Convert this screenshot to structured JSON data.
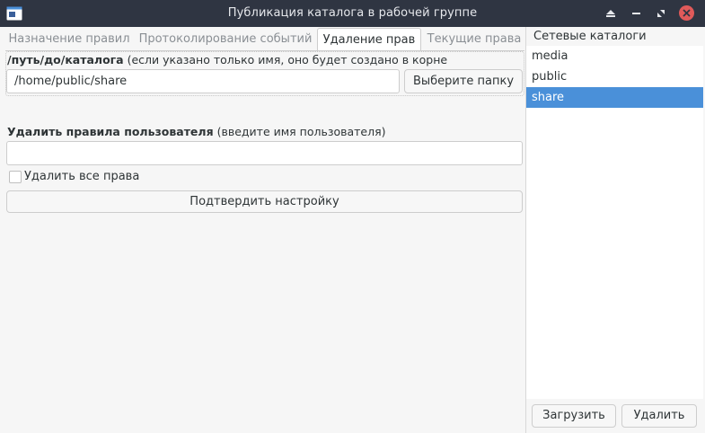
{
  "window": {
    "title": "Публикация каталога в рабочей группе",
    "accent_color": "#4a90d9",
    "close_color": "#e05a5a"
  },
  "tabs": [
    {
      "label": "Назначение правил",
      "active": false
    },
    {
      "label": "Протоколирование событий",
      "active": false
    },
    {
      "label": "Удаление прав",
      "active": true
    },
    {
      "label": "Текущие права",
      "active": false
    }
  ],
  "form": {
    "path_label_bold": "/путь/до/каталога",
    "path_label_hint": "(если указано только имя, оно будет создано в корне",
    "path_value": "/home/public/share",
    "choose_folder_label": "Выберите папку",
    "user_label_bold": "Удалить правила пользователя",
    "user_label_hint": "(введите имя пользователя)",
    "user_value": "",
    "delete_all_label": "Удалить все права",
    "delete_all_checked": false,
    "confirm_label": "Подтвердить настройку"
  },
  "network": {
    "title": "Сетевые каталоги",
    "items": [
      "media",
      "public",
      "share"
    ],
    "selected": "share",
    "load_label": "Загрузить",
    "delete_label": "Удалить"
  }
}
